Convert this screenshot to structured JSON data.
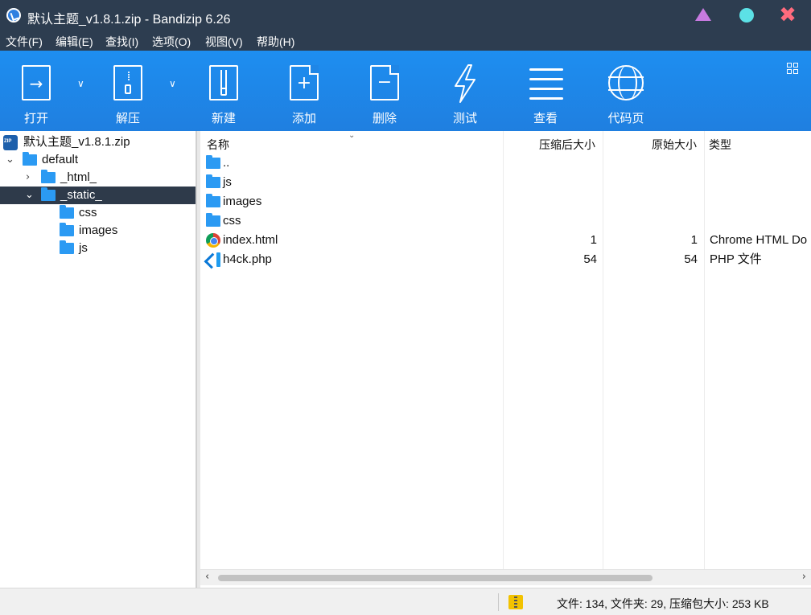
{
  "window": {
    "title": "默认主题_v1.8.1.zip - Bandizip 6.26",
    "close_glyph": "✖"
  },
  "menu": [
    "文件(F)",
    "编辑(E)",
    "查找(I)",
    "选项(O)",
    "视图(V)",
    "帮助(H)"
  ],
  "toolbar": {
    "open": "打开",
    "extract": "解压",
    "new": "新建",
    "add": "添加",
    "delete": "删除",
    "test": "测试",
    "view": "查看",
    "codepage": "代码页",
    "dropdown_glyph": "∨"
  },
  "tree": {
    "root": "默认主题_v1.8.1.zip",
    "items": [
      {
        "label": "default"
      },
      {
        "label": "_html_"
      },
      {
        "label": "_static_"
      },
      {
        "label": "css"
      },
      {
        "label": "images"
      },
      {
        "label": "js"
      }
    ]
  },
  "list": {
    "columns": {
      "name": "名称",
      "compressed": "压缩后大小",
      "original": "原始大小",
      "type": "类型"
    },
    "rows": [
      {
        "name": "..",
        "compressed": "",
        "original": "",
        "type": ""
      },
      {
        "name": "js",
        "compressed": "",
        "original": "",
        "type": ""
      },
      {
        "name": "images",
        "compressed": "",
        "original": "",
        "type": ""
      },
      {
        "name": "css",
        "compressed": "",
        "original": "",
        "type": ""
      },
      {
        "name": "index.html",
        "compressed": "1",
        "original": "1",
        "type": "Chrome HTML Do"
      },
      {
        "name": "h4ck.php",
        "compressed": "54",
        "original": "54",
        "type": "PHP 文件"
      }
    ]
  },
  "status": {
    "text": "文件: 134, 文件夹: 29, 压缩包大小: 253 KB"
  },
  "colors": {
    "titlebar": "#2d3d50",
    "toolbar": "#1f86e6",
    "selection": "#2e3a4a",
    "folder": "#2b9af3"
  }
}
